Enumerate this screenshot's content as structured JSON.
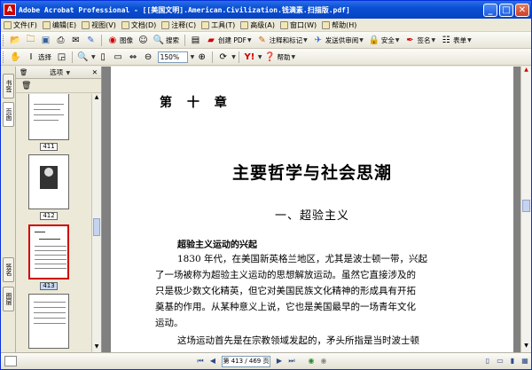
{
  "window": {
    "title": "Adobe Acrobat Professional - [[美国文明].American.Civilization.钱满素.扫描版.pdf]",
    "app_icon": "acrobat-icon"
  },
  "menubar": {
    "items": [
      "文件(F)",
      "编辑(E)",
      "视图(V)",
      "文档(D)",
      "注释(C)",
      "工具(T)",
      "高级(A)",
      "窗口(W)",
      "帮助(H)"
    ]
  },
  "toolbar1": {
    "search_label": "搜索",
    "image_label": "图像",
    "create_pdf_label": "创建 PDF",
    "review_label": "注释和标记",
    "send_label": "发送供审阅",
    "secure_label": "安全",
    "sign_label": "签名",
    "forms_label": "表单"
  },
  "toolbar2": {
    "select_label": "选择",
    "zoom_value": "150%",
    "help_label": "帮助"
  },
  "side_tabs": {
    "bookmarks": "书签",
    "pages": "页面",
    "signatures": "签名",
    "layers": "图层"
  },
  "pages_panel": {
    "options_label": "选项",
    "thumbnails": [
      {
        "num": "411"
      },
      {
        "num": "412"
      },
      {
        "num": "413"
      }
    ]
  },
  "document": {
    "chapter": "第 十 章",
    "title": "主要哲学与社会思潮",
    "section": "一、超验主义",
    "subheading": "超验主义运动的兴起",
    "lines": [
      "1830 年代，在美国新英格兰地区，尤其是波士顿一带，兴起",
      "了一场被称为超验主义运动的思想解放运动。虽然它直接涉及的",
      "只是极少数文化精英，但它对美国民族文化精神的形成具有开拓",
      "奠基的作用。从某种意义上说，它也是美国最早的一场青年文化",
      "运动。",
      "这场运动首先是在宗教领域发起的，矛头所指是当时波士顿"
    ]
  },
  "statusbar": {
    "page_display": "第 413 / 469 页"
  }
}
